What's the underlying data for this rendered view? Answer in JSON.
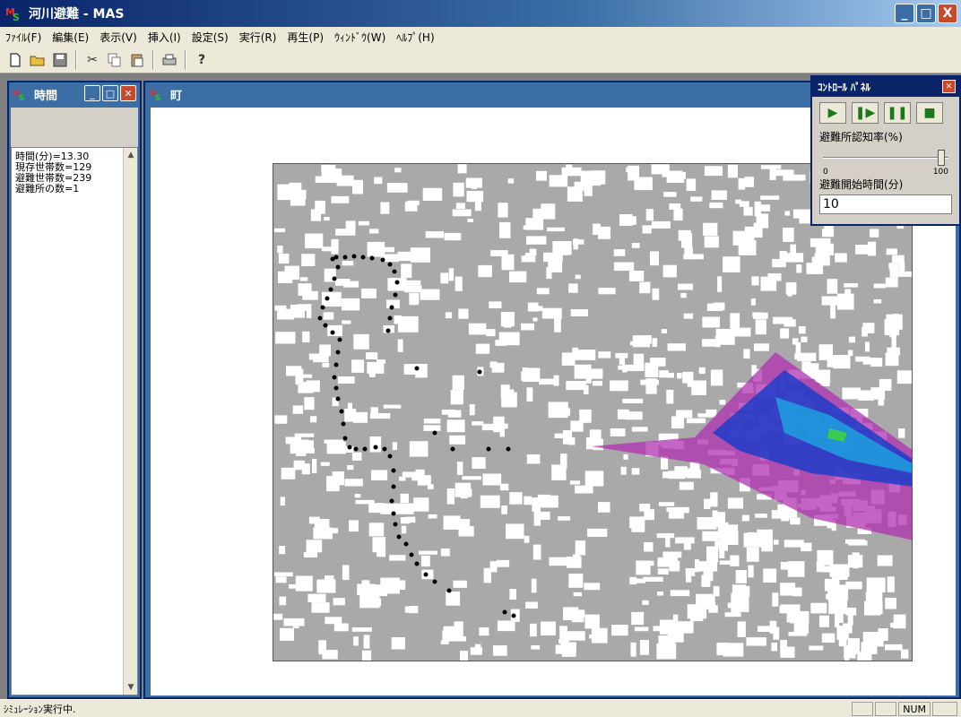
{
  "app": {
    "title": "河川避難 - MAS",
    "window_controls": [
      "_",
      "□",
      "X"
    ]
  },
  "menu": [
    "ﾌｧｲﾙ(F)",
    "編集(E)",
    "表示(V)",
    "挿入(I)",
    "設定(S)",
    "実行(R)",
    "再生(P)",
    "ｳｨﾝﾄﾞｳ(W)",
    "ﾍﾙﾌﾟ(H)"
  ],
  "toolbar": {
    "icons": [
      "new-file-icon",
      "open-folder-icon",
      "save-icon",
      "cut-icon",
      "copy-icon",
      "paste-icon",
      "print-icon",
      "help-icon"
    ]
  },
  "time_window": {
    "title": "時間",
    "lines": [
      "時間(分)=13.30",
      "現存世帯数=129",
      "避難世帯数=239",
      "避難所の数=1"
    ]
  },
  "map_window": {
    "title": "町"
  },
  "control_panel": {
    "title": "ｺﾝﾄﾛｰﾙ ﾊﾟﾈﾙ",
    "awareness_label": "避難所認知率(%)",
    "slider_min": "0",
    "slider_max": "100",
    "slider_value": 100,
    "start_time_label": "避難開始時間(分)",
    "start_time_value": "10"
  },
  "status": {
    "text": "ｼﾐｭﾚｰｼｮﾝ実行中.",
    "num": "NUM"
  },
  "colors": {
    "titlebar": "#0a246a",
    "map_background": "#a9a9a9",
    "building": "#ffffff",
    "agent": "#000000",
    "flood_magenta": "#b030b0",
    "flood_blue": "#1e3cc8",
    "flood_cyan": "#20a0e0",
    "flood_green": "#40d040"
  }
}
